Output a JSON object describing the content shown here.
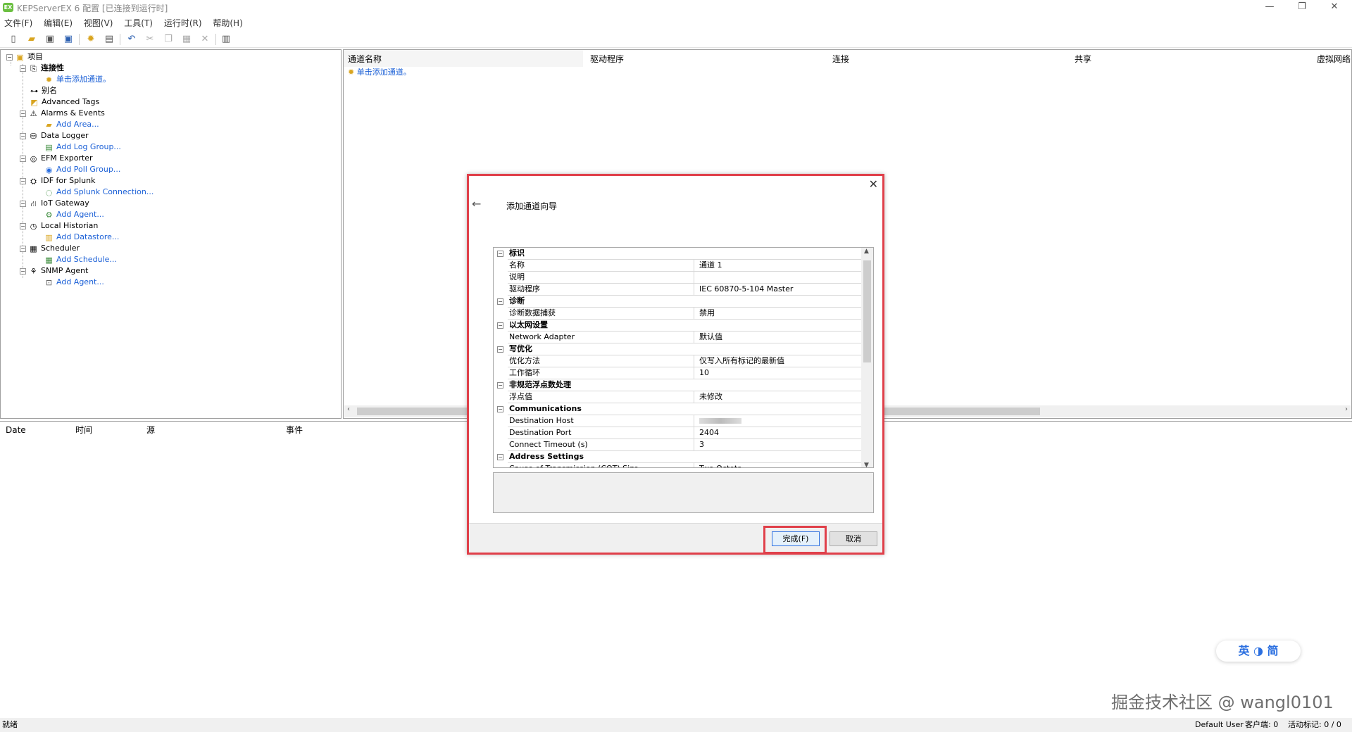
{
  "window": {
    "title": "KEPServerEX 6 配置 [已连接到运行时]",
    "app_icon": "EX",
    "minimize": "—",
    "restore": "❐",
    "close": "✕"
  },
  "menu": [
    "文件(F)",
    "编辑(E)",
    "视图(V)",
    "工具(T)",
    "运行时(R)",
    "帮助(H)"
  ],
  "tree": {
    "root": "项目",
    "items": [
      {
        "label": "连接性",
        "bold": true,
        "icon": "connectivity-icon"
      },
      {
        "label": "单击添加通道。",
        "link": true,
        "icon": "add-channel-icon"
      },
      {
        "label": "别名",
        "icon": "alias-icon"
      },
      {
        "label": "Advanced Tags",
        "icon": "advanced-tags-icon"
      },
      {
        "label": "Alarms & Events",
        "icon": "alarm-icon"
      },
      {
        "label": "Add Area...",
        "link": true,
        "icon": "add-area-icon"
      },
      {
        "label": "Data Logger",
        "icon": "database-icon"
      },
      {
        "label": "Add Log Group...",
        "link": true,
        "icon": "add-log-group-icon"
      },
      {
        "label": "EFM Exporter",
        "icon": "efm-icon"
      },
      {
        "label": "Add Poll Group...",
        "link": true,
        "icon": "add-poll-group-icon"
      },
      {
        "label": "IDF for Splunk",
        "icon": "splunk-icon"
      },
      {
        "label": "Add Splunk Connection...",
        "link": true,
        "icon": "add-splunk-icon"
      },
      {
        "label": "IoT Gateway",
        "icon": "iot-gateway-icon"
      },
      {
        "label": "Add Agent...",
        "link": true,
        "icon": "add-agent-icon"
      },
      {
        "label": "Local Historian",
        "icon": "clock-icon"
      },
      {
        "label": "Add Datastore...",
        "link": true,
        "icon": "add-datastore-icon"
      },
      {
        "label": "Scheduler",
        "icon": "calendar-icon"
      },
      {
        "label": "Add Schedule...",
        "link": true,
        "icon": "add-schedule-icon"
      },
      {
        "label": "SNMP Agent",
        "icon": "snmp-icon"
      },
      {
        "label": "Add Agent...",
        "link": true,
        "icon": "add-snmp-agent-icon"
      }
    ]
  },
  "list": {
    "columns": [
      "通道名称",
      "驱动程序",
      "连接",
      "共享",
      "虚拟网络"
    ],
    "add_link": "单击添加通道。"
  },
  "event_log": {
    "columns": [
      "Date",
      "时间",
      "源",
      "事件"
    ]
  },
  "statusbar": {
    "left": "就绪",
    "user": "Default User",
    "clients": "客户端: 0",
    "active_tags": "活动标记: 0 / 0"
  },
  "dialog": {
    "title": "添加通道向导",
    "back_icon": "←",
    "close_icon": "✕",
    "rows": [
      {
        "type": "cat",
        "k": "标识"
      },
      {
        "type": "prop",
        "k": "名称",
        "v": "通道 1"
      },
      {
        "type": "prop",
        "k": "说明",
        "v": ""
      },
      {
        "type": "prop",
        "k": "驱动程序",
        "v": "IEC 60870-5-104 Master"
      },
      {
        "type": "cat",
        "k": "诊断"
      },
      {
        "type": "prop",
        "k": "诊断数据捕获",
        "v": "禁用"
      },
      {
        "type": "cat",
        "k": "以太网设置"
      },
      {
        "type": "prop",
        "k": "Network Adapter",
        "v": "默认值"
      },
      {
        "type": "cat",
        "k": "写优化"
      },
      {
        "type": "prop",
        "k": "优化方法",
        "v": "仅写入所有标记的最新值"
      },
      {
        "type": "prop",
        "k": "工作循环",
        "v": "10"
      },
      {
        "type": "cat",
        "k": "非规范浮点数处理"
      },
      {
        "type": "prop",
        "k": "浮点值",
        "v": "未修改"
      },
      {
        "type": "cat",
        "k": "Communications"
      },
      {
        "type": "prop",
        "k": "Destination Host",
        "v": ""
      },
      {
        "type": "prop",
        "k": "Destination Port",
        "v": "2404"
      },
      {
        "type": "prop",
        "k": "Connect Timeout (s)",
        "v": "3"
      },
      {
        "type": "cat",
        "k": "Address Settings"
      },
      {
        "type": "prop",
        "k": "Cause of Transmission (COT) Size",
        "v": "Two Octets"
      }
    ],
    "finish_label": "完成(F)",
    "cancel_label": "取消"
  },
  "ime": "英 ◑ 简",
  "watermark": "掘金技术社区 @ wangl0101",
  "colors": {
    "highlight_red": "#e0404a",
    "link_blue": "#1a5fd6"
  }
}
